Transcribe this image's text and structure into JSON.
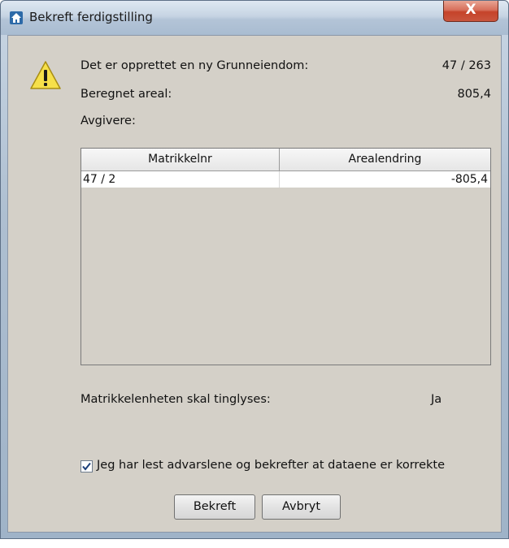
{
  "window": {
    "title": "Bekreft ferdigstilling",
    "close_label": "X"
  },
  "info": {
    "row1_label": "Det er opprettet en ny Grunneiendom:",
    "row1_value": "47 / 263",
    "row2_label": "Beregnet areal:",
    "row2_value": "805,4",
    "avgivere_label": "Avgivere:"
  },
  "table": {
    "columns": [
      "Matrikkelnr",
      "Arealendring"
    ],
    "rows": [
      [
        "47 / 2",
        "-805,4"
      ]
    ]
  },
  "tinglysing": {
    "label": "Matrikkelenheten skal tinglyses:",
    "value": "Ja"
  },
  "confirm_checkbox": {
    "label": "Jeg har lest advarslene og bekrefter at dataene er korrekte",
    "checked": true
  },
  "buttons": {
    "confirm": "Bekreft",
    "cancel": "Avbryt"
  },
  "icons": [
    "home-icon",
    "close-icon",
    "warning-icon",
    "checkmark-icon"
  ]
}
